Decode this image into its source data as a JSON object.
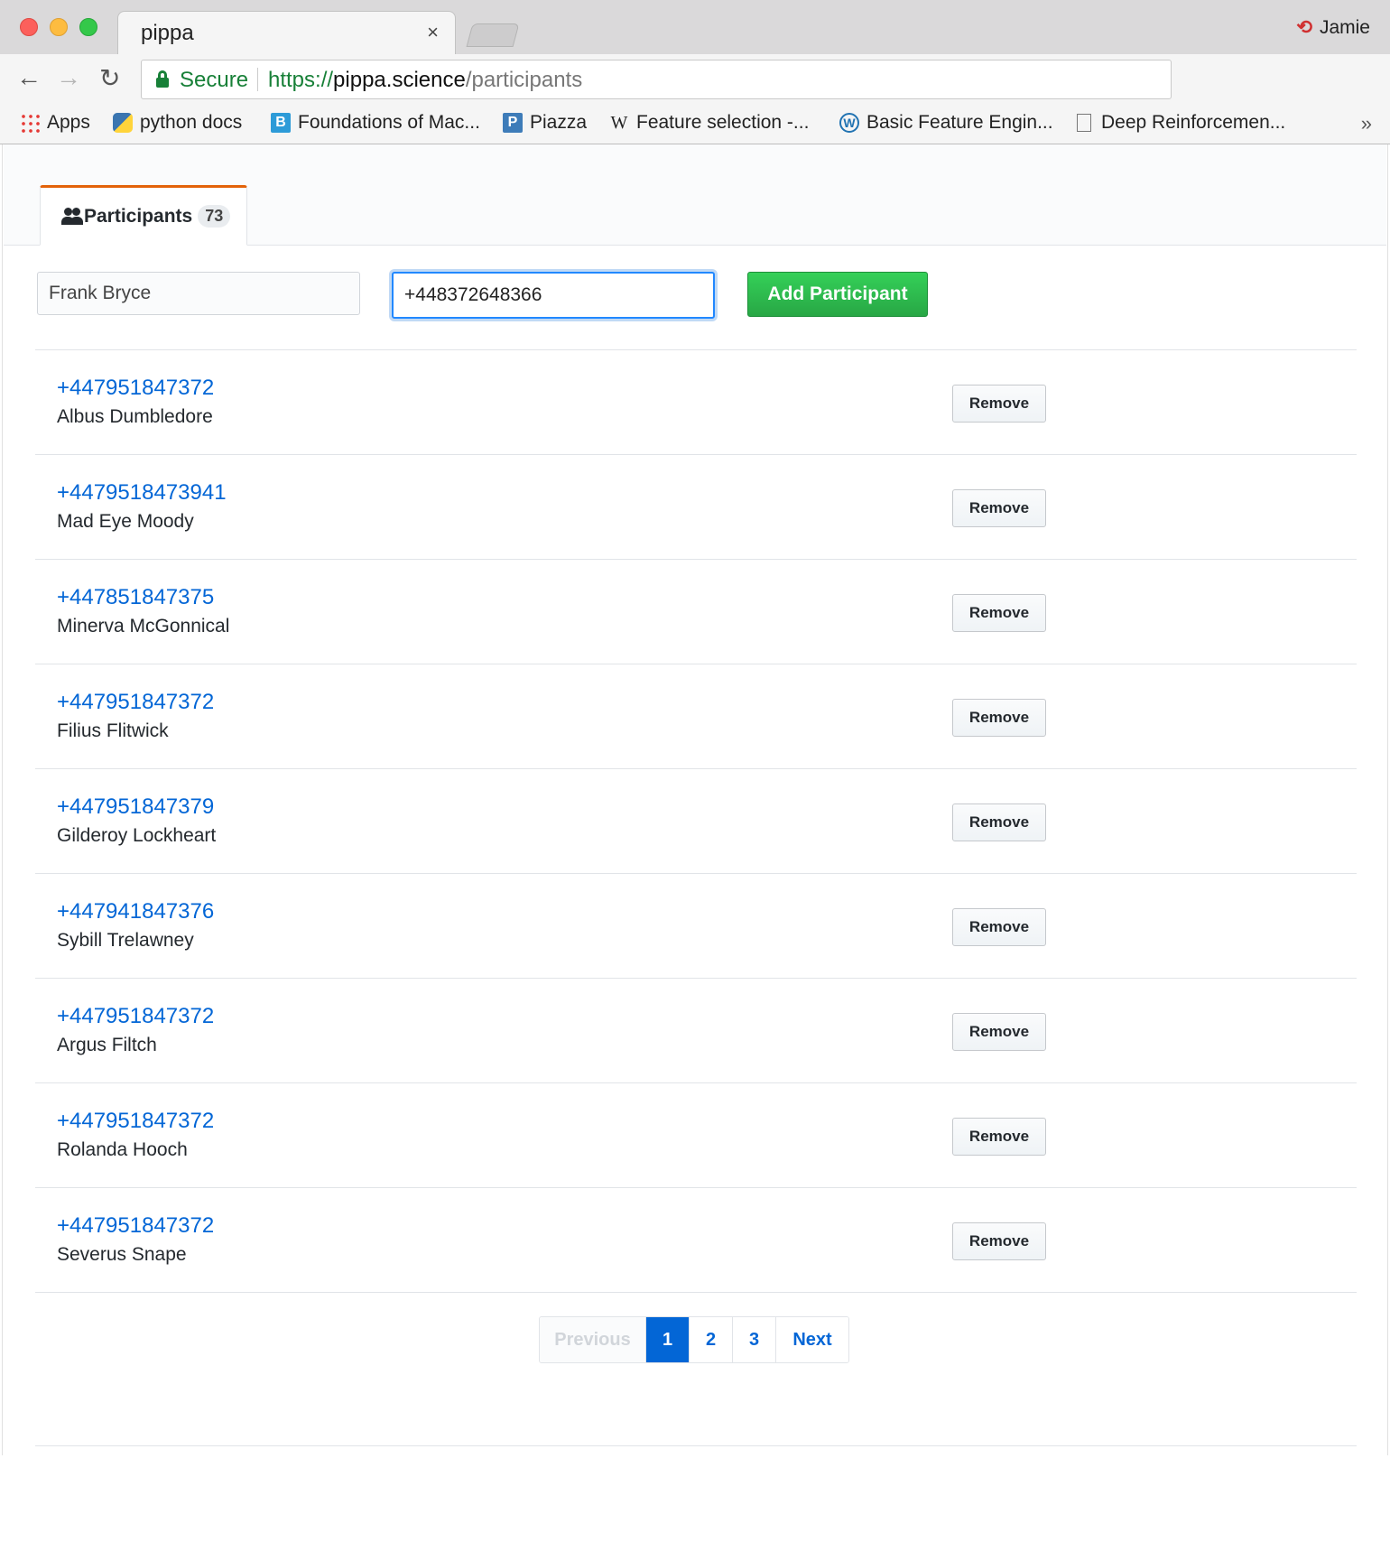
{
  "browser": {
    "tab_title": "pippa",
    "tab_close": "×",
    "profile_name": "Jamie",
    "url_scheme": "https://",
    "url_host": "pippa.science",
    "url_path": "/participants",
    "secure_label": "Secure",
    "nav": {
      "back": "←",
      "forward": "→",
      "reload": "↻"
    },
    "bookmarks": [
      {
        "label": "Apps",
        "icon": "apps-grid-icon"
      },
      {
        "label": "python docs",
        "icon": "python-icon",
        "glyph": ""
      },
      {
        "label": "Foundations of Mac...",
        "icon": "b-logo-icon",
        "glyph": "B"
      },
      {
        "label": "Piazza",
        "icon": "piazza-icon",
        "glyph": "P"
      },
      {
        "label": "Feature selection -...",
        "icon": "wikipedia-icon",
        "glyph": "W"
      },
      {
        "label": "Basic Feature Engin...",
        "icon": "wordpress-icon",
        "glyph": "W"
      },
      {
        "label": "Deep Reinforcemen...",
        "icon": "document-icon",
        "glyph": ""
      }
    ],
    "bookmarks_more": "»"
  },
  "page": {
    "tab": {
      "label": "Participants",
      "count": "73"
    },
    "form": {
      "name_value": "Frank Bryce",
      "phone_value": "+448372648366",
      "add_label": "Add Participant"
    },
    "remove_label": "Remove",
    "participants": [
      {
        "phone": "+447951847372",
        "name": "Albus Dumbledore"
      },
      {
        "phone": "+4479518473941",
        "name": "Mad Eye Moody"
      },
      {
        "phone": "+447851847375",
        "name": "Minerva McGonnical"
      },
      {
        "phone": "+447951847372",
        "name": "Filius Flitwick"
      },
      {
        "phone": "+447951847379",
        "name": "Gilderoy Lockheart"
      },
      {
        "phone": "+447941847376",
        "name": "Sybill Trelawney"
      },
      {
        "phone": "+447951847372",
        "name": "Argus Filtch"
      },
      {
        "phone": "+447951847372",
        "name": "Rolanda Hooch"
      },
      {
        "phone": "+447951847372",
        "name": "Severus Snape"
      }
    ],
    "pagination": {
      "previous": "Previous",
      "pages": [
        "1",
        "2",
        "3"
      ],
      "current": "1",
      "next": "Next"
    }
  },
  "colors": {
    "link": "#0366d6",
    "add_button": "#28a745",
    "tab_accent": "#e36209",
    "secure": "#188038"
  }
}
